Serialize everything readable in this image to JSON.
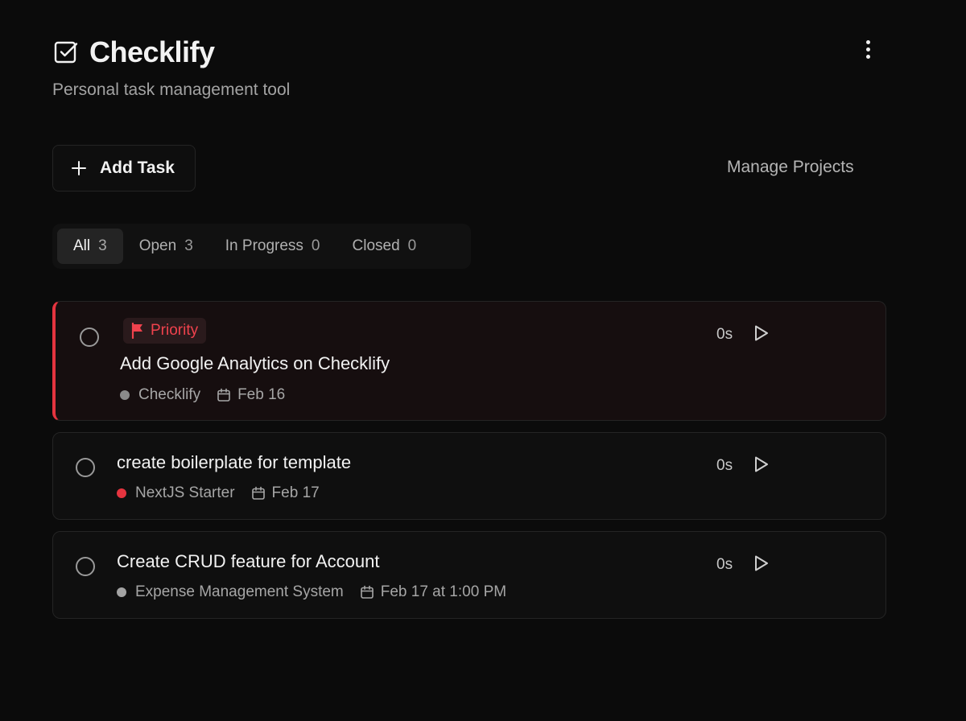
{
  "app": {
    "title": "Checklify",
    "subtitle": "Personal task management tool"
  },
  "actions": {
    "add_task_label": "Add Task",
    "manage_projects_label": "Manage Projects"
  },
  "tabs": [
    {
      "label": "All",
      "count": "3",
      "active": true
    },
    {
      "label": "Open",
      "count": "3",
      "active": false
    },
    {
      "label": "In Progress",
      "count": "0",
      "active": false
    },
    {
      "label": "Closed",
      "count": "0",
      "active": false
    }
  ],
  "tasks": [
    {
      "priority": true,
      "priority_label": "Priority",
      "title": "Add Google Analytics on Checklify",
      "project": "Checklify",
      "project_color": "#8a8a8a",
      "due": "Feb 16",
      "timer": "0s"
    },
    {
      "priority": false,
      "title": "create boilerplate for template",
      "project": "NextJS Starter",
      "project_color": "#e5343f",
      "due": "Feb 17",
      "timer": "0s"
    },
    {
      "priority": false,
      "title": "Create CRUD feature for Account",
      "project": "Expense Management System",
      "project_color": "#a3a3a3",
      "due": "Feb 17 at 1:00 PM",
      "timer": "0s"
    }
  ],
  "colors": {
    "background": "#0b0b0b",
    "priority_accent": "#e5343f",
    "text_primary": "#f2f2f2",
    "text_muted": "#a6a6a6"
  },
  "icons": {
    "logo": "checkbox-check-icon",
    "menu": "kebab-menu-icon",
    "add": "plus-icon",
    "priority": "flag-icon",
    "date": "calendar-icon",
    "start": "play-icon",
    "status": "circle-checkbox-icon"
  }
}
